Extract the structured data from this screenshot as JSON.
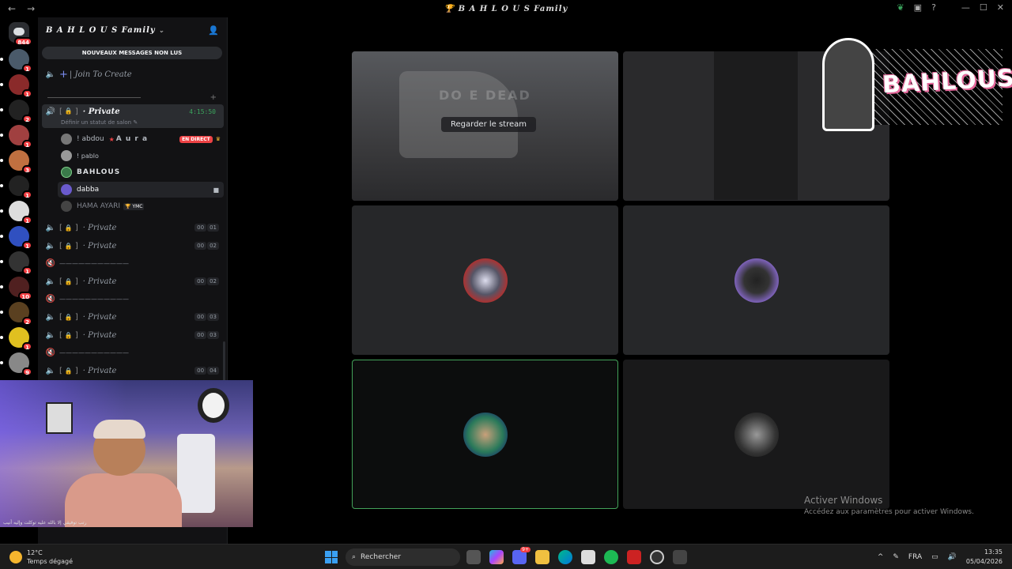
{
  "window": {
    "title": "B A H L O U S Family",
    "back": "←",
    "forward": "→",
    "minimize": "—",
    "maximize": "☐",
    "close": "✕",
    "help": "?"
  },
  "rail": {
    "home_badge": "844",
    "servers": [
      {
        "badge": "1",
        "color": "#4a5a6a"
      },
      {
        "badge": "1",
        "color": "#8a2a2a"
      },
      {
        "badge": "2",
        "color": "#222"
      },
      {
        "badge": "1",
        "color": "#a04040"
      },
      {
        "badge": "3",
        "color": "#c07040"
      },
      {
        "badge": "1",
        "color": "#222"
      },
      {
        "badge": "1",
        "color": "#ddd"
      },
      {
        "badge": "1",
        "color": "#3050c0"
      },
      {
        "badge": "1",
        "color": "#333"
      },
      {
        "badge": "10",
        "color": "#502020"
      },
      {
        "badge": "2",
        "color": "#5a4020"
      },
      {
        "badge": "1",
        "color": "#e0c020"
      },
      {
        "badge": "9",
        "color": "#888"
      }
    ]
  },
  "sidebar": {
    "server_name": "B A H L O U S Family",
    "unread_pill": "NOUVEAUX MESSAGES NON LUS",
    "join_channel": "Join To Create",
    "active_channel": {
      "bracket_open": "[",
      "bracket_close": "]",
      "name": "· Private",
      "timer": "4:15:50",
      "status_hint": "Définir un statut de salon"
    },
    "members": [
      {
        "name": "! abdou",
        "extra": "A u r a",
        "live": "EN DIRECT"
      },
      {
        "name": "! pablo"
      },
      {
        "name": "BAHLOUS"
      },
      {
        "name": "dabba"
      },
      {
        "name": "HAMA AYARI",
        "tag": "YMC"
      }
    ],
    "channels": [
      {
        "name": "· Private",
        "c1": "00",
        "c2": "01"
      },
      {
        "name": "· Private",
        "c1": "00",
        "c2": "02"
      },
      {
        "name": "· Private",
        "c1": "00",
        "c2": "02"
      },
      {
        "name": "· Private",
        "c1": "00",
        "c2": "03"
      },
      {
        "name": "· Private",
        "c1": "00",
        "c2": "03"
      },
      {
        "name": "· Private",
        "c1": "00",
        "c2": "04"
      }
    ],
    "separator": "———————————"
  },
  "webcam": {
    "ticker": "رتب توفيقي إلا بالله عليه توكلت وإليه أنيب"
  },
  "stage": {
    "stream_title": "DO  E DEAD",
    "watch_button": "Regarder le stream"
  },
  "brand": {
    "wordmark": "BAHLOUS"
  },
  "watermark": {
    "line1": "Activer Windows",
    "line2": "Accédez aux paramètres pour activer Windows."
  },
  "taskbar": {
    "temp": "12°C",
    "weather": "Temps dégagé",
    "search": "Rechercher",
    "discord_badge": "9+",
    "lang": "FRA",
    "time": "13:35",
    "date": "05/04/2026",
    "tray_up": "^"
  }
}
